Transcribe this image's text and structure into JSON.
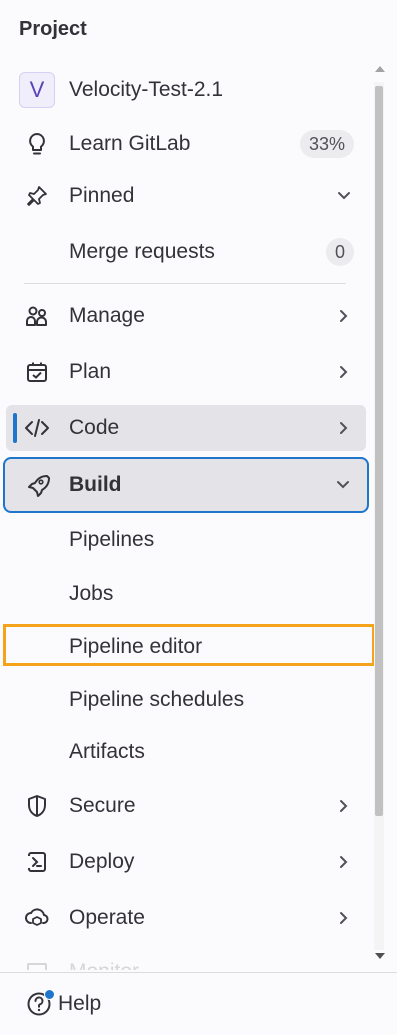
{
  "sidebar": {
    "header": "Project",
    "project": {
      "initial": "V",
      "name": "Velocity-Test-2.1"
    },
    "learn": {
      "label": "Learn GitLab",
      "badge": "33%"
    },
    "pinned": {
      "label": "Pinned",
      "items": [
        {
          "label": "Merge requests",
          "badge": "0"
        }
      ]
    },
    "nav": [
      {
        "label": "Manage",
        "icon": "manage-icon"
      },
      {
        "label": "Plan",
        "icon": "plan-icon"
      },
      {
        "label": "Code",
        "icon": "code-icon"
      },
      {
        "label": "Build",
        "icon": "build-icon"
      }
    ],
    "build_items": [
      "Pipelines",
      "Jobs",
      "Pipeline editor",
      "Pipeline schedules",
      "Artifacts"
    ],
    "nav2": [
      {
        "label": "Secure",
        "icon": "shield-icon"
      },
      {
        "label": "Deploy",
        "icon": "deploy-icon"
      },
      {
        "label": "Operate",
        "icon": "operate-icon"
      },
      {
        "label": "Monitor",
        "icon": "monitor-icon"
      }
    ],
    "help": "Help"
  },
  "colors": {
    "accent": "#1f75cb",
    "highlight": "#f5a31a",
    "active_bg": "#e4e3e8"
  }
}
